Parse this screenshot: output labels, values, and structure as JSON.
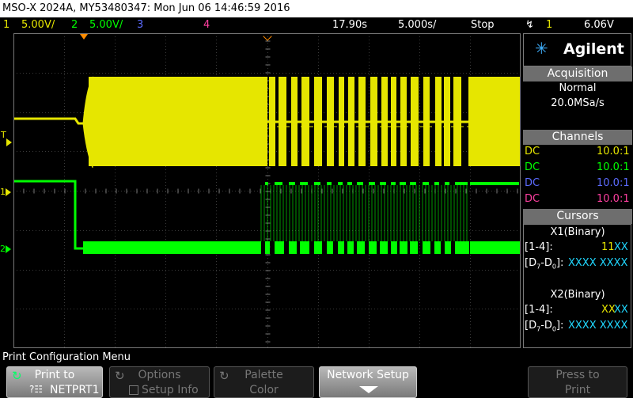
{
  "title_bar": "MSO-X 2024A, MY53480347: Mon Jun 06 14:46:59 2016",
  "status": {
    "ch1_num": "1",
    "ch1_scale": "5.00V/",
    "ch2_num": "2",
    "ch2_scale": "5.00V/",
    "ch3_num": "3",
    "ch4_num": "4",
    "delay": "17.90s",
    "timebase": "5.000s/",
    "run_state": "Stop",
    "trigger_source": "1",
    "trigger_level": "6.06V"
  },
  "panel": {
    "brand": "Agilent",
    "acquisition": {
      "header": "Acquisition",
      "mode": "Normal",
      "rate": "20.0MSa/s"
    },
    "channels": {
      "header": "Channels",
      "rows": [
        {
          "coupling": "DC",
          "probe": "10.0:1"
        },
        {
          "coupling": "DC",
          "probe": "10.0:1"
        },
        {
          "coupling": "DC",
          "probe": "10.0:1"
        },
        {
          "coupling": "DC",
          "probe": "10.0:1"
        }
      ]
    },
    "cursors": {
      "header": "Cursors",
      "x1_title": "X1(Binary)",
      "x1_range_label": "[1-4]:",
      "x1_range_val_a": "11",
      "x1_range_val_b": "XX",
      "x1_digital_label": "[D7-D0]:",
      "x1_digital_val": "XXXX XXXX",
      "x2_title": "X2(Binary)",
      "x2_range_label": "[1-4]:",
      "x2_range_val_a": "XX",
      "x2_range_val_b": "XX",
      "x2_digital_label": "[D7-D0]:",
      "x2_digital_val": "XXXX XXXX"
    }
  },
  "markers": {
    "trigger_letter": "T",
    "ch1_marker": "1",
    "ch2_marker": "2"
  },
  "menu": {
    "title": "Print Configuration Menu",
    "softkeys": [
      {
        "line1": "Print to",
        "line2": "NETPRT1"
      },
      {
        "line1": "Options",
        "line2": "Setup Info"
      },
      {
        "line1": "Palette",
        "line2": "Color"
      },
      {
        "line1": "Network Setup",
        "line2": ""
      },
      {
        "line1": "Press to",
        "line2": "Print"
      }
    ]
  },
  "colors": {
    "ch1": "#e6e600",
    "ch2": "#00ff00",
    "ch3": "#5c6bff",
    "ch4": "#ff3fa0",
    "cursor_cyan": "#20d8ff"
  }
}
